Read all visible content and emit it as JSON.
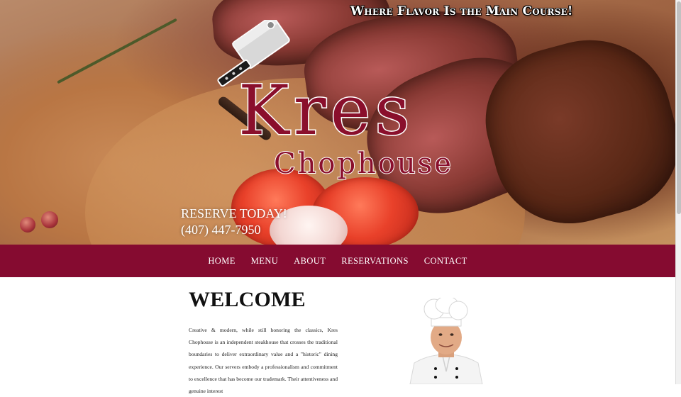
{
  "header": {
    "tagline": "Where Flavor Is the Main Course!",
    "logo": {
      "name": "Kres",
      "subtitle": "Chophouse"
    },
    "reserve": {
      "label": "RESERVE TODAY!",
      "phone": "(407) 447-7950"
    }
  },
  "nav": {
    "items": [
      {
        "label": "HOME"
      },
      {
        "label": "MENU"
      },
      {
        "label": "ABOUT"
      },
      {
        "label": "RESERVATIONS"
      },
      {
        "label": "CONTACT"
      }
    ]
  },
  "main": {
    "heading": "WELCOME",
    "intro": "Creative & modern, while still honoring the classics, Kres Chophouse is an independent steakhouse that crosses the traditional boundaries to deliver extraordinary value and a \"historic\" dining experience. Our servers embody a professionalism and commitment to excellence that has become our trademark. Their attentiveness and genuine interest"
  },
  "colors": {
    "brand": "#850b30",
    "logo_fill": "#8a0f2c",
    "text": "#222222"
  },
  "icons": [
    "cleaver-icon",
    "chef-photo"
  ]
}
